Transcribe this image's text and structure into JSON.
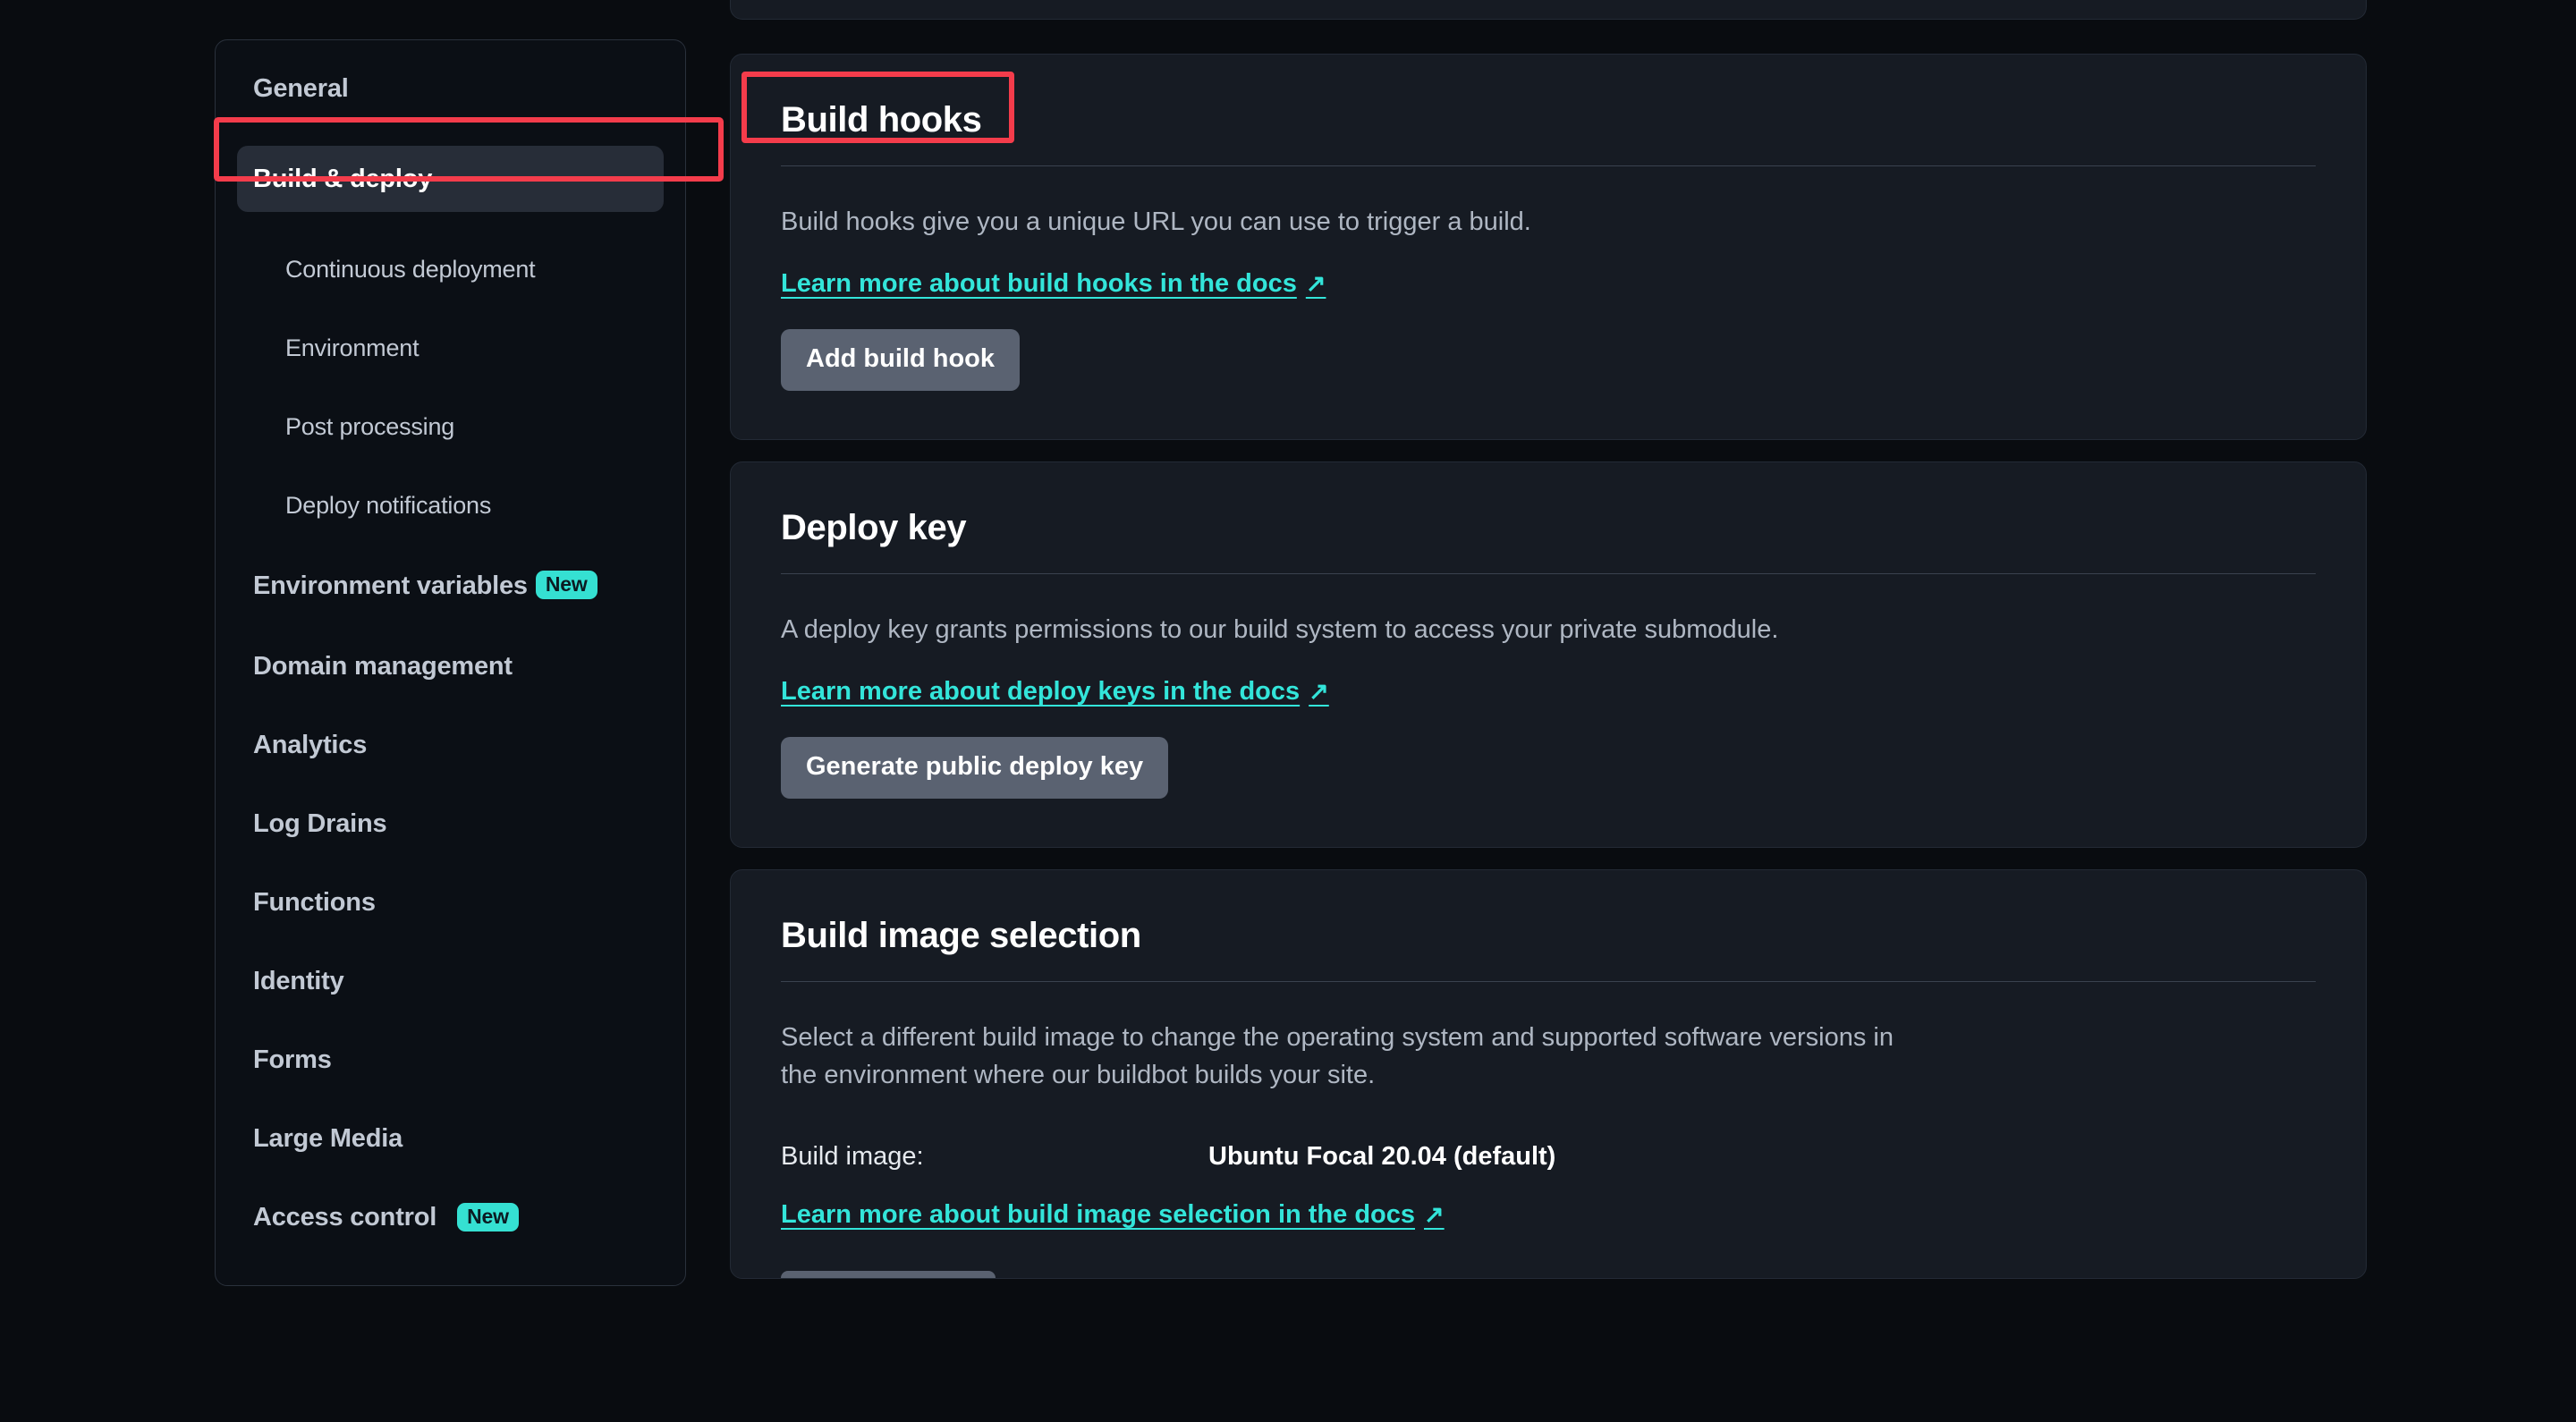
{
  "sidebar": {
    "items": [
      {
        "label": "General",
        "type": "top",
        "active": false,
        "badge": null
      },
      {
        "label": "Build & deploy",
        "type": "top",
        "active": true,
        "badge": null
      },
      {
        "label": "Continuous deployment",
        "type": "sub",
        "active": false,
        "badge": null
      },
      {
        "label": "Environment",
        "type": "sub",
        "active": false,
        "badge": null
      },
      {
        "label": "Post processing",
        "type": "sub",
        "active": false,
        "badge": null
      },
      {
        "label": "Deploy notifications",
        "type": "sub",
        "active": false,
        "badge": null
      },
      {
        "label": "Environment variables",
        "type": "top",
        "active": false,
        "badge": "New"
      },
      {
        "label": "Domain management",
        "type": "top",
        "active": false,
        "badge": null
      },
      {
        "label": "Analytics",
        "type": "top",
        "active": false,
        "badge": null
      },
      {
        "label": "Log Drains",
        "type": "top",
        "active": false,
        "badge": null
      },
      {
        "label": "Functions",
        "type": "top",
        "active": false,
        "badge": null
      },
      {
        "label": "Identity",
        "type": "top",
        "active": false,
        "badge": null
      },
      {
        "label": "Forms",
        "type": "top",
        "active": false,
        "badge": null
      },
      {
        "label": "Large Media",
        "type": "top",
        "active": false,
        "badge": null
      },
      {
        "label": "Access control",
        "type": "top",
        "active": false,
        "badge": "New"
      }
    ]
  },
  "main": {
    "build_hooks": {
      "title": "Build hooks",
      "description": "Build hooks give you a unique URL you can use to trigger a build.",
      "link": "Learn more about build hooks in the docs",
      "link_arrow": "↗",
      "button": "Add build hook"
    },
    "deploy_key": {
      "title": "Deploy key",
      "description": "A deploy key grants permissions to our build system to access your private submodule.",
      "link": "Learn more about deploy keys in the docs",
      "link_arrow": "↗",
      "button": "Generate public deploy key"
    },
    "build_image": {
      "title": "Build image selection",
      "description": "Select a different build image to change the operating system and supported software versions in the environment where our buildbot builds your site.",
      "field_label": "Build image:",
      "field_value": "Ubuntu Focal 20.04 (default)",
      "link": "Learn more about build image selection in the docs",
      "link_arrow": "↗"
    }
  },
  "colors": {
    "page_background": "#090C10",
    "card_background": "#161B23",
    "sidebar_background": "#0B0F15",
    "accent_link": "#33E5DA",
    "badge_new": "#35E0D2",
    "button": "#5A6271",
    "highlight_annotation": "#F43C4B",
    "active_nav": "#272D38"
  }
}
